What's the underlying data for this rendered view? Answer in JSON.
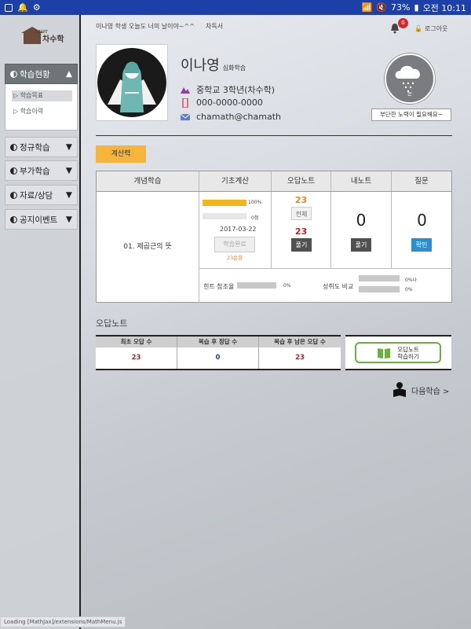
{
  "status_bar": {
    "battery": "73%",
    "time": "오전 10:11"
  },
  "sidebar": {
    "logo_small": "SMART",
    "logo_text": "차수학",
    "menus": [
      {
        "label": "학습현황",
        "arrow": "▲",
        "active": true
      },
      {
        "label": "정규학습",
        "arrow": "▼"
      },
      {
        "label": "부가학습",
        "arrow": "▼"
      },
      {
        "label": "자료/상담",
        "arrow": "▼"
      },
      {
        "label": "공지이벤트",
        "arrow": "▼"
      }
    ],
    "submenu": [
      "▷ 학습목표",
      "▷ 학습이력"
    ],
    "loading_text": "Loading [MathJax]/extensions/MathMenu.js"
  },
  "header": {
    "greeting": "이나영 학생 오늘도 너의 날이야~^^",
    "link": "차독서",
    "notif_count": "0",
    "logout": "로그아웃"
  },
  "profile": {
    "name": "이나영",
    "course": "심화학습",
    "grade": "중학교 3학년(차수학)",
    "phone": "000-0000-0000",
    "email": "chamath@chamath"
  },
  "weather": {
    "label": "눈",
    "motto": "부단한 노력이 필요해요~"
  },
  "tab": {
    "label": "계산력"
  },
  "study_table": {
    "headers": [
      "개념학습",
      "기초계산",
      "오답노트",
      "내노트",
      "질문"
    ],
    "lesson": "01. 제곱근의 뜻",
    "progress_pct": "100%",
    "progress_fill": 1.0,
    "count_label": "0점",
    "date": "2017-03-22",
    "done_label": "학습완료",
    "question_count": "23문항",
    "wrong_all_num": "23",
    "wrong_all_btn": "전체",
    "wrong_solve_num": "23",
    "wrong_solve_btn": "풀기",
    "my_note_num": "0",
    "my_note_btn": "풀기",
    "question_num": "0",
    "question_btn": "확인",
    "hint_label": "힌트 참조율",
    "hint_pct": "0%",
    "achieve_label": "성취도 비교",
    "achieve_pct1": "0%나",
    "achieve_pct2": "0%"
  },
  "wrong_note": {
    "title": "오답노트",
    "headers": [
      "최초 오답 수",
      "복습 후 정답 수",
      "복습 후 남은 오답 수"
    ],
    "values": [
      "23",
      "0",
      "23"
    ],
    "learn_btn_line1": "오답노트",
    "learn_btn_line2": "학습하기"
  },
  "next_label": "다음학습 >",
  "colors": {
    "status": "#1c3fa8",
    "accent": "#f6b53a",
    "red": "#d9262b",
    "green": "#6bb23d",
    "blue": "#2a8fd1"
  }
}
